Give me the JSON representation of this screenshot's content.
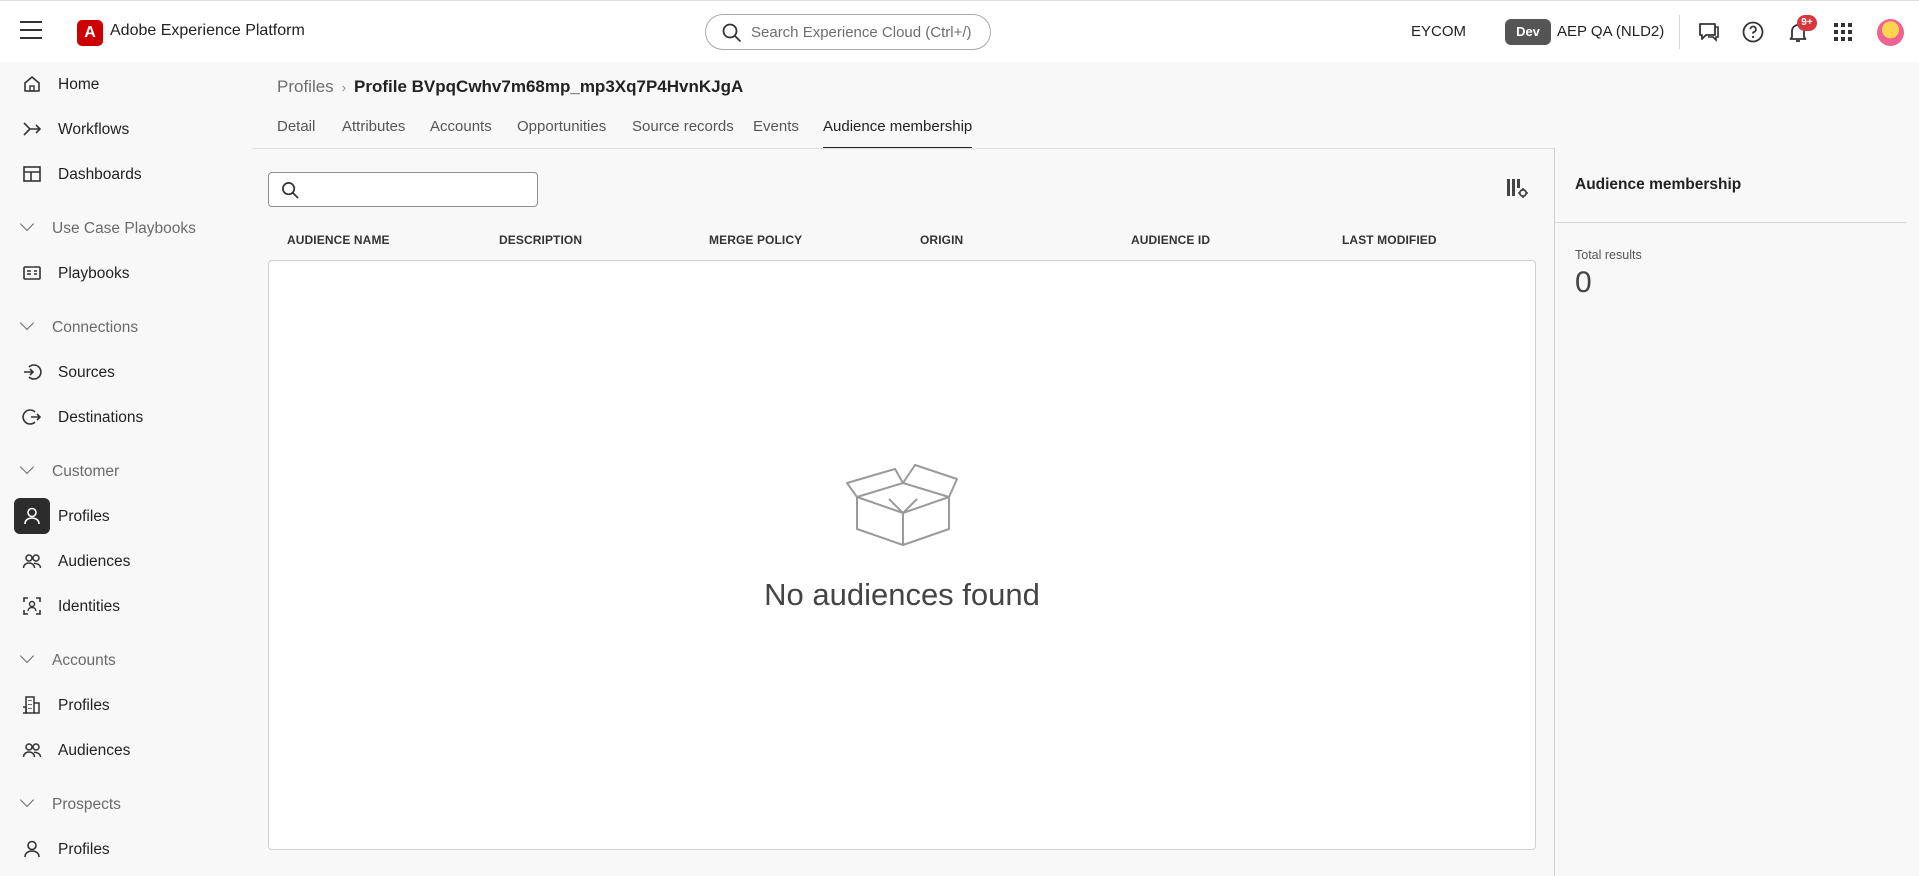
{
  "app": {
    "brand": "Adobe Experience Platform",
    "logo_letter": "A"
  },
  "topbar": {
    "search_placeholder": "Search Experience Cloud (Ctrl+/)",
    "org": "EYCOM",
    "env_badge": "Dev",
    "sandbox": "AEP QA (NLD2)",
    "notification_count": "9+"
  },
  "sidebar": {
    "home": "Home",
    "workflows": "Workflows",
    "dashboards": "Dashboards",
    "section_playbooks": "Use Case Playbooks",
    "playbooks": "Playbooks",
    "section_connections": "Connections",
    "sources": "Sources",
    "destinations": "Destinations",
    "section_customer": "Customer",
    "customer_profiles": "Profiles",
    "customer_audiences": "Audiences",
    "identities": "Identities",
    "section_accounts": "Accounts",
    "accounts_profiles": "Profiles",
    "accounts_audiences": "Audiences",
    "section_prospects": "Prospects",
    "prospects_profiles": "Profiles"
  },
  "breadcrumb": {
    "parent": "Profiles",
    "sep": "›",
    "current": "Profile BVpqCwhv7m68mp_mp3Xq7P4HvnKJgA"
  },
  "tabs": [
    "Detail",
    "Attributes",
    "Accounts",
    "Opportunities",
    "Source records",
    "Events",
    "Audience membership"
  ],
  "table": {
    "columns": [
      "AUDIENCE NAME",
      "DESCRIPTION",
      "MERGE POLICY",
      "ORIGIN",
      "AUDIENCE ID",
      "LAST MODIFIED"
    ],
    "empty_message": "No audiences found"
  },
  "rail": {
    "title": "Audience membership",
    "total_label": "Total results",
    "total_value": "0"
  }
}
